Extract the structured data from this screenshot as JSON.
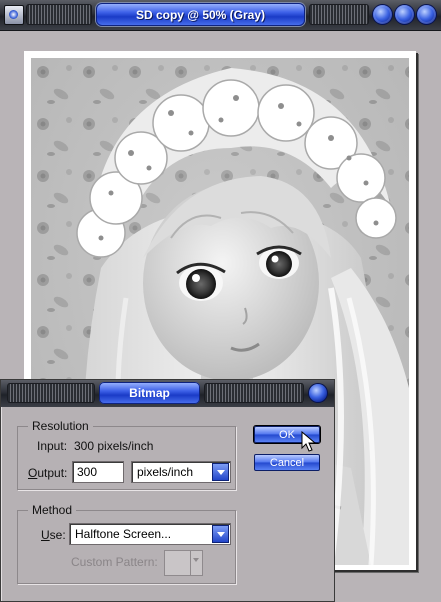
{
  "window": {
    "title": "SD copy @ 50% (Gray)",
    "icon": "photoshop-app-icon",
    "controls": [
      "minimize-icon",
      "maximize-icon",
      "close-icon"
    ]
  },
  "dialog": {
    "title": "Bitmap",
    "resolution": {
      "group_label": "Resolution",
      "input_label": "Input:",
      "input_value": "300 pixels/inch",
      "output_label_underlined": "O",
      "output_label_rest": "utput:",
      "output_value": "300",
      "output_unit": "pixels/inch"
    },
    "method": {
      "group_label": "Method",
      "use_label_underlined": "U",
      "use_label_rest": "se:",
      "use_value": "Halftone Screen...",
      "custom_pattern_label": "Custom Pattern:"
    },
    "buttons": {
      "ok": "OK",
      "cancel": "Cancel"
    }
  },
  "colors": {
    "accent": "#2f55e0",
    "titlebar": "#2a2d34",
    "window_bg": "#b9b4b7"
  }
}
